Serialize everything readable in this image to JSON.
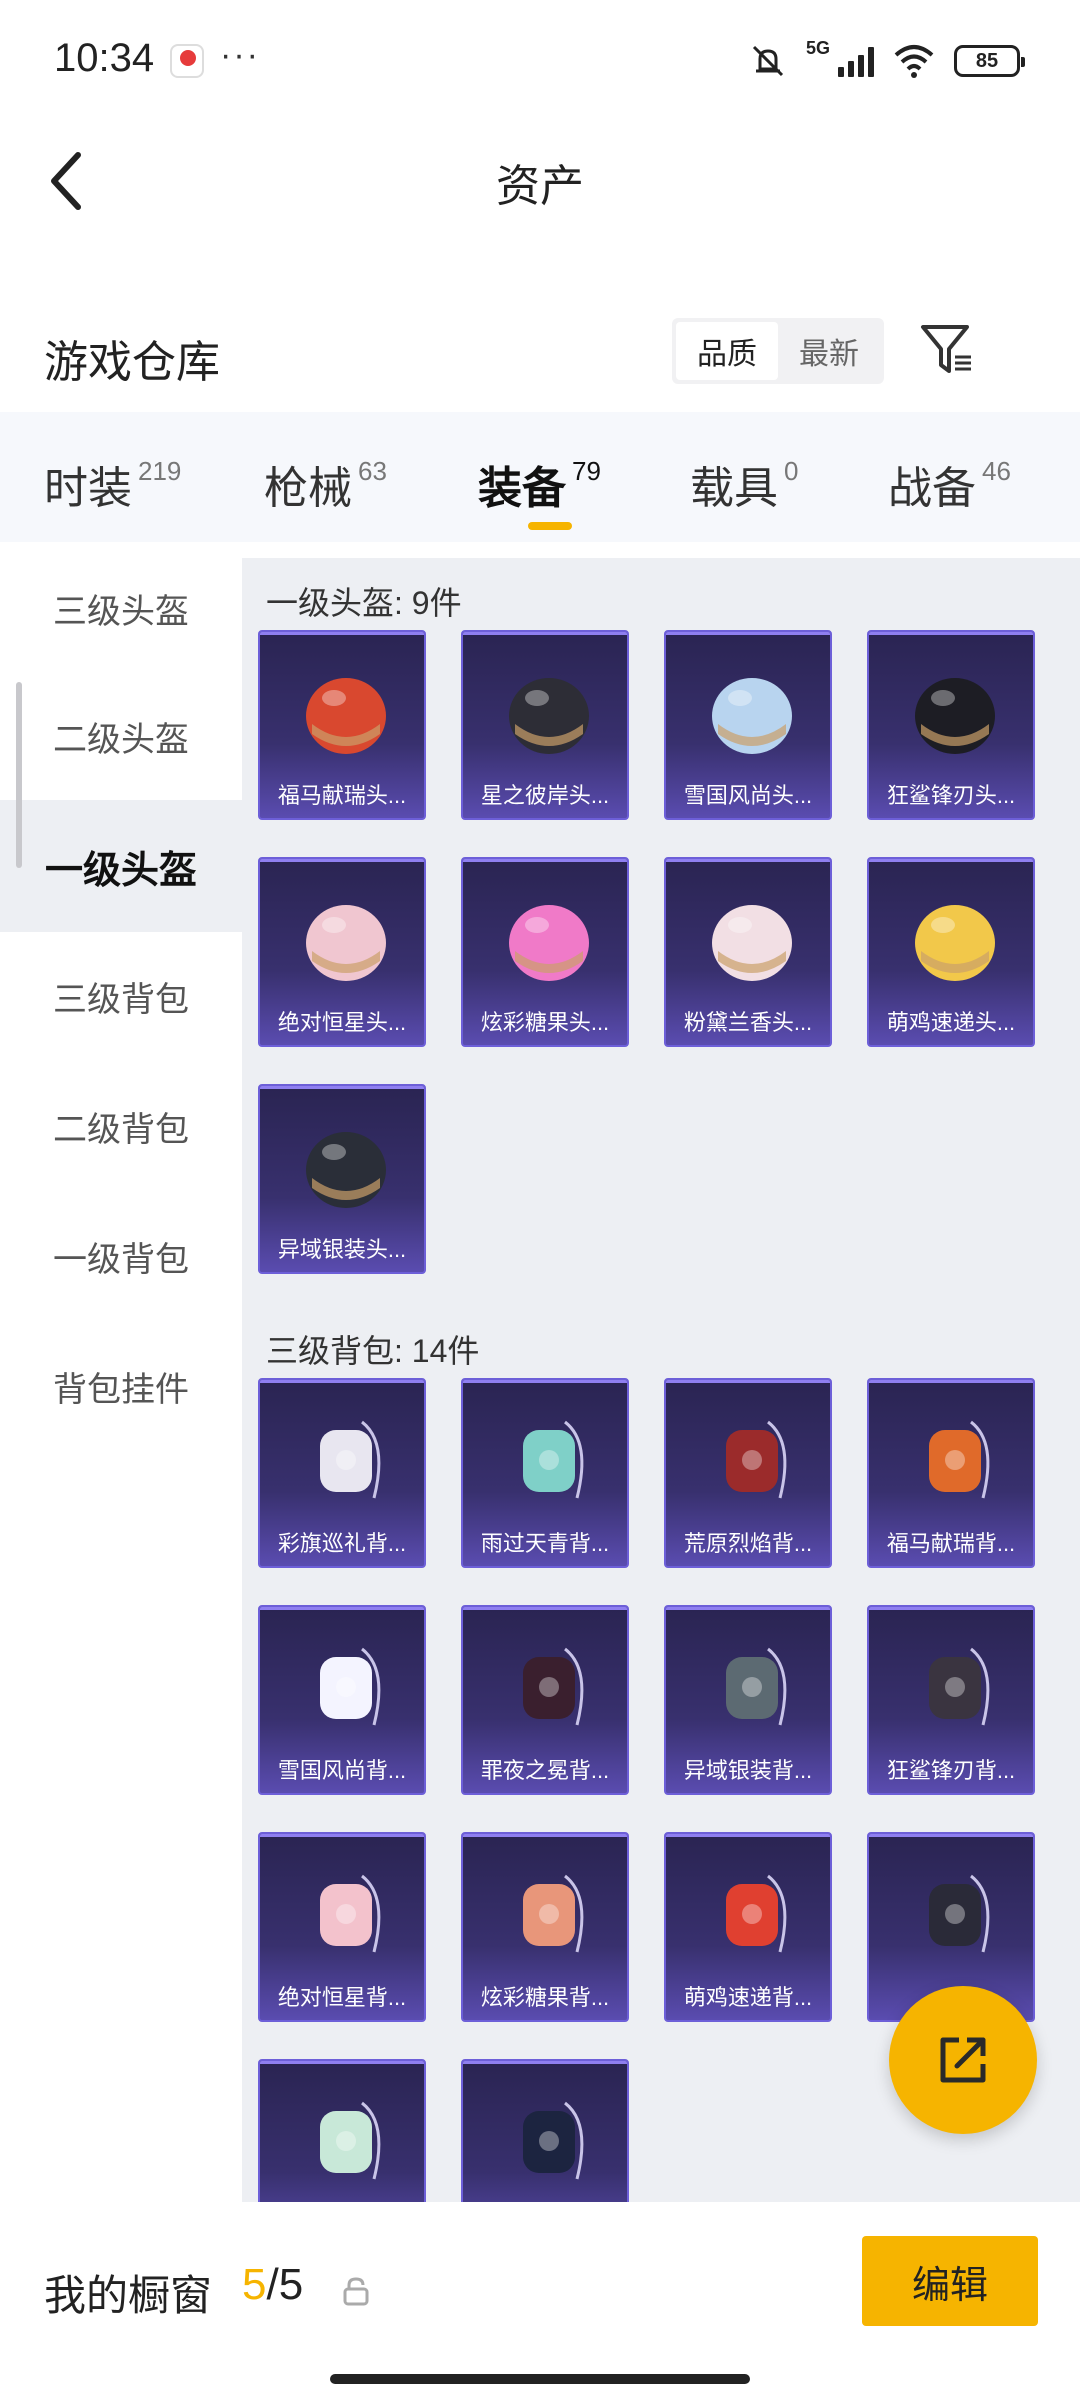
{
  "status": {
    "time": "10:34",
    "network": "5G",
    "battery": "85"
  },
  "header": {
    "title": "资产"
  },
  "section": {
    "title": "游戏仓库",
    "sort_options": [
      "品质",
      "最新"
    ],
    "active_sort": "品质"
  },
  "tabs": [
    {
      "label": "时装",
      "count": "219"
    },
    {
      "label": "枪械",
      "count": "63"
    },
    {
      "label": "装备",
      "count": "79",
      "active": true
    },
    {
      "label": "载具",
      "count": "0"
    },
    {
      "label": "战备",
      "count": "46"
    }
  ],
  "sidebar": {
    "items": [
      {
        "label": "三级头盔"
      },
      {
        "label": "二级头盔"
      },
      {
        "label": "一级头盔",
        "active": true
      },
      {
        "label": "三级背包"
      },
      {
        "label": "二级背包"
      },
      {
        "label": "一级背包"
      },
      {
        "label": "背包挂件"
      }
    ]
  },
  "groups": [
    {
      "title": "一级头盔: 9件",
      "items": [
        "福马献瑞头...",
        "星之彼岸头...",
        "雪国风尚头...",
        "狂鲨锋刃头...",
        "绝对恒星头...",
        "炫彩糖果头...",
        "粉黛兰香头...",
        "萌鸡速递头...",
        "异域银装头..."
      ]
    },
    {
      "title": "三级背包: 14件",
      "items": [
        "彩旗巡礼背...",
        "雨过天青背...",
        "荒原烈焰背...",
        "福马献瑞背...",
        "雪国风尚背...",
        "罪夜之冕背...",
        "异域银装背...",
        "狂鲨锋刃背...",
        "绝对恒星背...",
        "炫彩糖果背...",
        "萌鸡速递背...",
        "",
        "",
        ""
      ]
    }
  ],
  "bottom": {
    "window_label": "我的橱窗",
    "window_current": "5",
    "window_total": "/5",
    "edit_label": "编辑"
  },
  "colors": {
    "accent": "#f6b400",
    "card_border": "#6d5fd8",
    "card_bg": "#2a2452"
  },
  "icons": {
    "back": "chevron-left-icon",
    "filter": "filter-icon",
    "share": "share-icon",
    "lock": "lock-icon"
  }
}
